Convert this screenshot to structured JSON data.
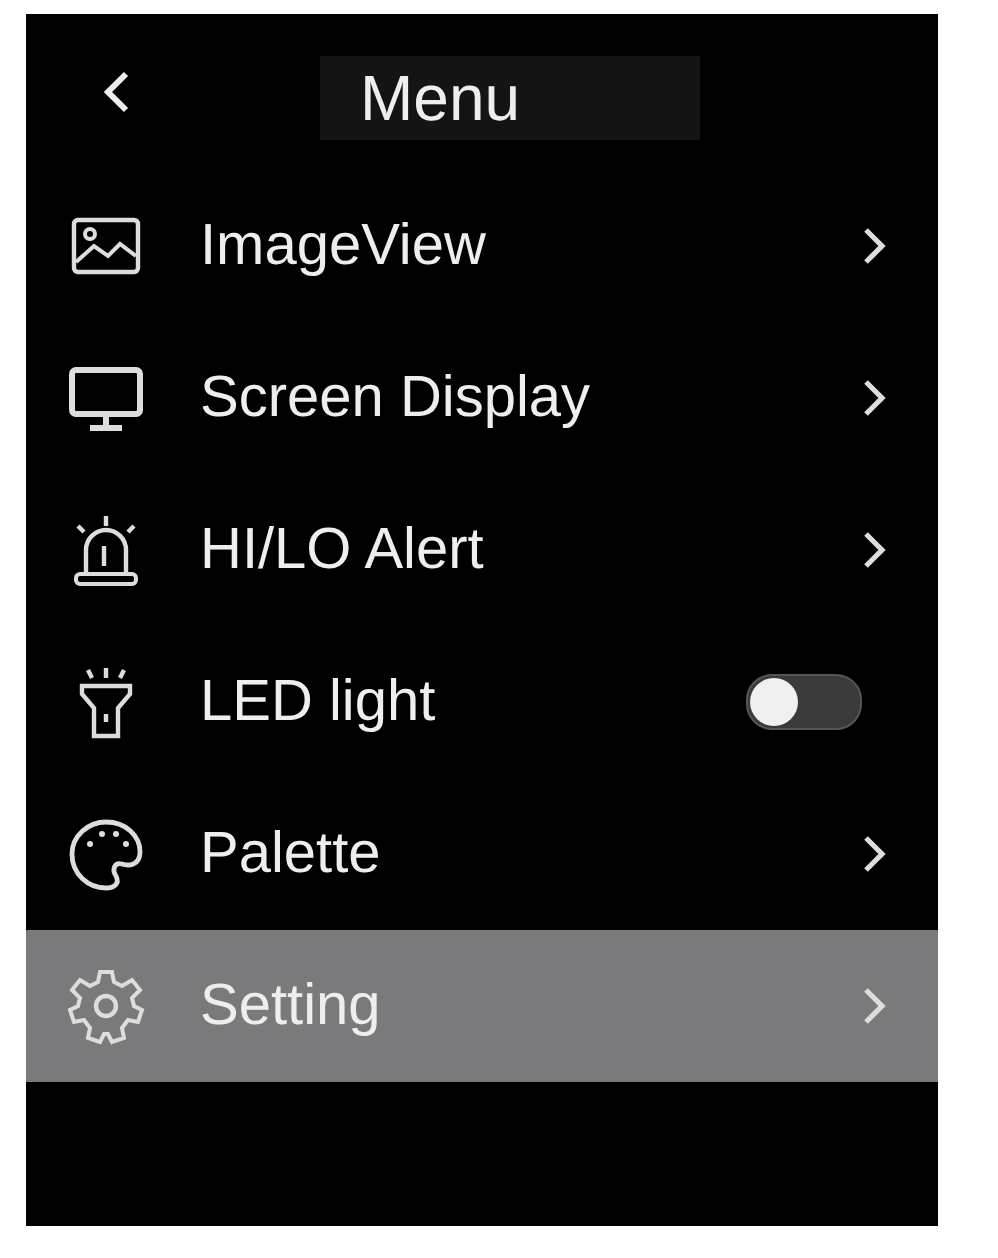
{
  "header": {
    "title": "Menu"
  },
  "items": [
    {
      "label": "ImageView",
      "kind": "submenu",
      "selected": false
    },
    {
      "label": "Screen Display",
      "kind": "submenu",
      "selected": false
    },
    {
      "label": "HI/LO Alert",
      "kind": "submenu",
      "selected": false
    },
    {
      "label": "LED light",
      "kind": "toggle",
      "on": false,
      "selected": false
    },
    {
      "label": "Palette",
      "kind": "submenu",
      "selected": false
    },
    {
      "label": "Setting",
      "kind": "submenu",
      "selected": true
    }
  ]
}
